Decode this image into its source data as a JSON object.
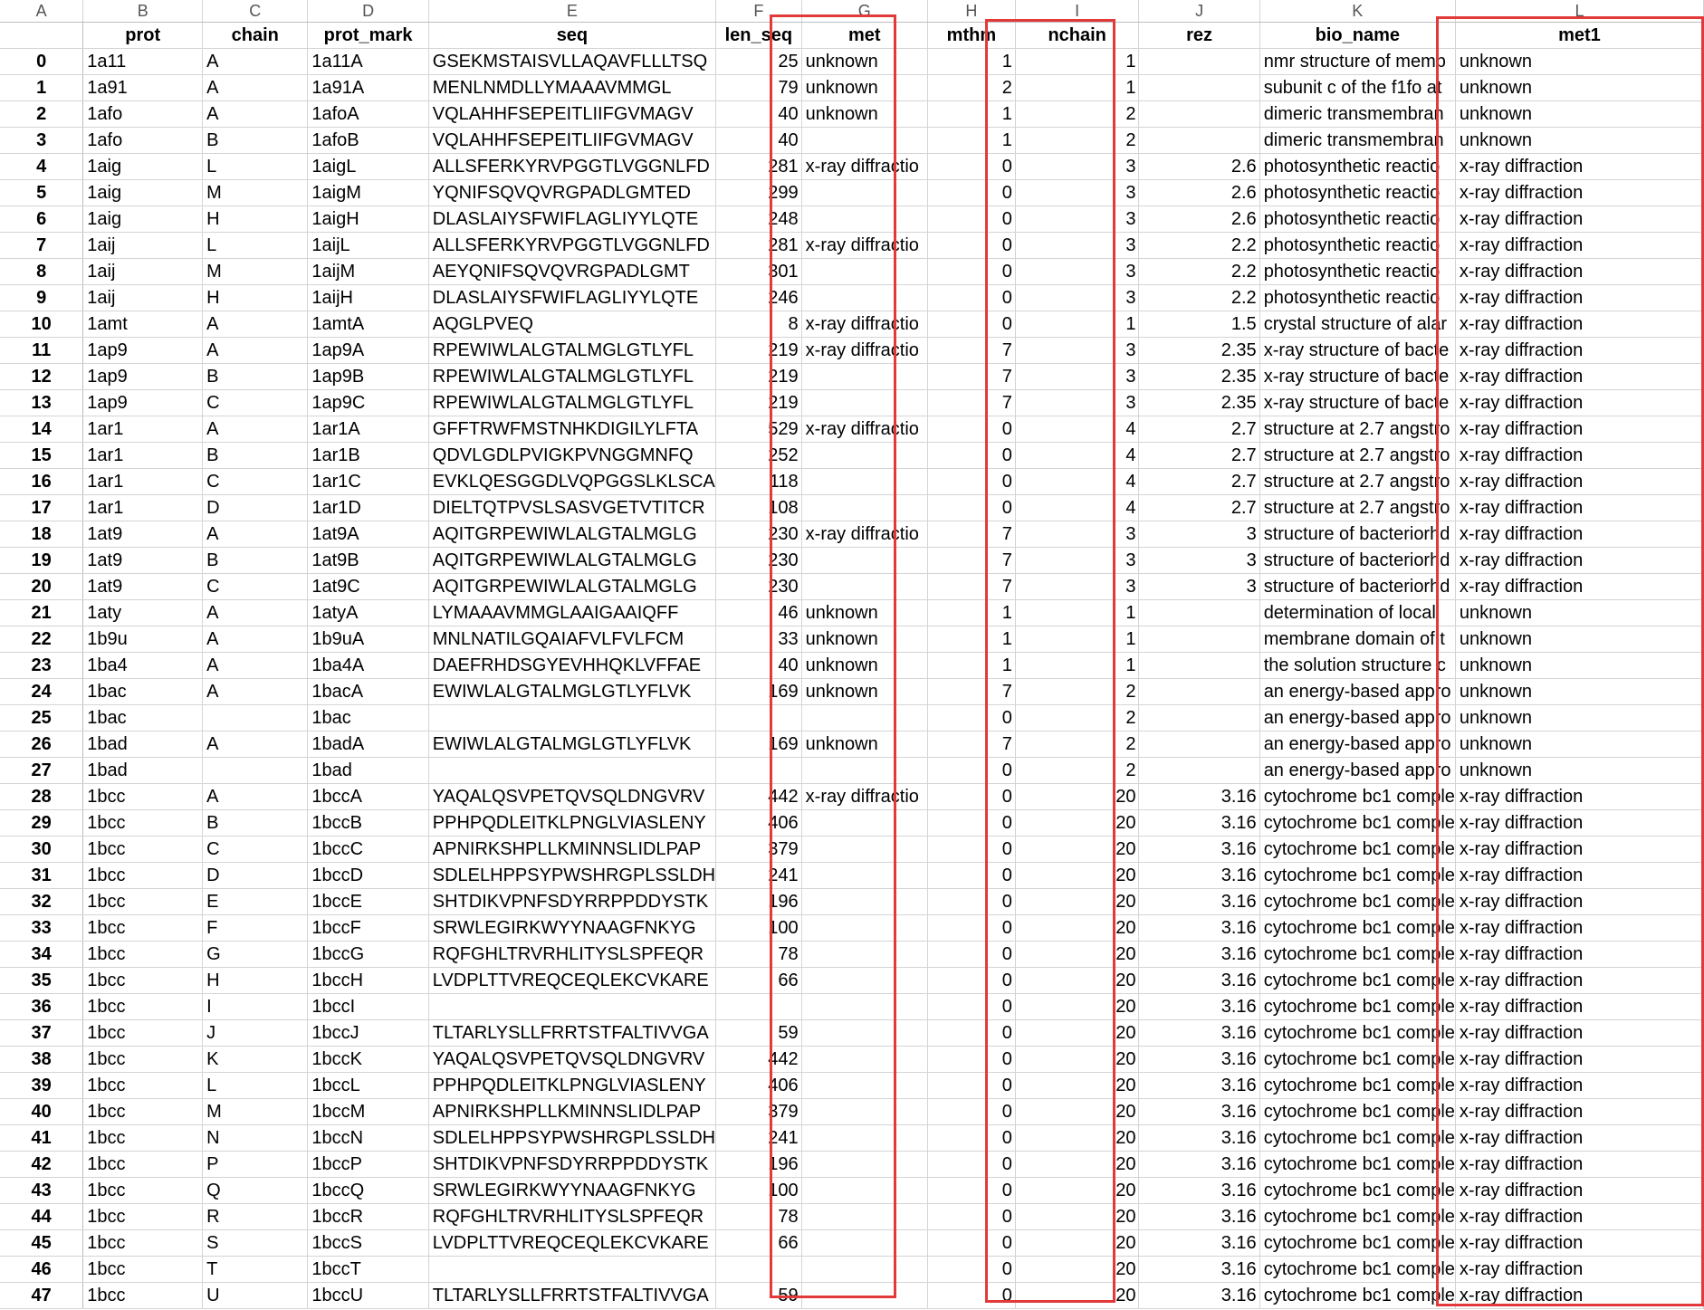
{
  "column_letters": [
    "A",
    "B",
    "C",
    "D",
    "E",
    "F",
    "G",
    "H",
    "I",
    "J",
    "K",
    "L"
  ],
  "headers": [
    "",
    "prot",
    "chain",
    "prot_mark",
    "seq",
    "len_seq",
    "met",
    "mthm",
    "nchain",
    "rez",
    "bio_name",
    "met1"
  ],
  "highlight_color": "#e23a3a",
  "highlighted_columns": [
    "met",
    "nchain",
    "met1"
  ],
  "rows": [
    [
      "0",
      "1a11",
      "A",
      "1a11A",
      "GSEKMSTAISVLLAQAVFLLLTSQ",
      "25",
      "unknown",
      "1",
      "1",
      "",
      "nmr structure of memb",
      "unknown"
    ],
    [
      "1",
      "1a91",
      "A",
      "1a91A",
      "MENLNMDLLYMAAAVMMGL",
      "79",
      "unknown",
      "2",
      "1",
      "",
      "subunit c of the f1fo at",
      "unknown"
    ],
    [
      "2",
      "1afo",
      "A",
      "1afoA",
      "VQLAHHFSEPEITLIIFGVMAGV",
      "40",
      "unknown",
      "1",
      "2",
      "",
      "dimeric transmembran",
      "unknown"
    ],
    [
      "3",
      "1afo",
      "B",
      "1afoB",
      "VQLAHHFSEPEITLIIFGVMAGV",
      "40",
      "",
      "1",
      "2",
      "",
      "dimeric transmembran",
      "unknown"
    ],
    [
      "4",
      "1aig",
      "L",
      "1aigL",
      "ALLSFERKYRVPGGTLVGGNLFD",
      "281",
      "x-ray diffractio",
      "0",
      "3",
      "2.6",
      "photosynthetic reactio",
      "x-ray diffraction"
    ],
    [
      "5",
      "1aig",
      "M",
      "1aigM",
      "YQNIFSQVQVRGPADLGMTED",
      "299",
      "",
      "0",
      "3",
      "2.6",
      "photosynthetic reactio",
      "x-ray diffraction"
    ],
    [
      "6",
      "1aig",
      "H",
      "1aigH",
      "DLASLAIYSFWIFLAGLIYYLQTE",
      "248",
      "",
      "0",
      "3",
      "2.6",
      "photosynthetic reactio",
      "x-ray diffraction"
    ],
    [
      "7",
      "1aij",
      "L",
      "1aijL",
      "ALLSFERKYRVPGGTLVGGNLFD",
      "281",
      "x-ray diffractio",
      "0",
      "3",
      "2.2",
      "photosynthetic reactio",
      "x-ray diffraction"
    ],
    [
      "8",
      "1aij",
      "M",
      "1aijM",
      "AEYQNIFSQVQVRGPADLGMT",
      "301",
      "",
      "0",
      "3",
      "2.2",
      "photosynthetic reactio",
      "x-ray diffraction"
    ],
    [
      "9",
      "1aij",
      "H",
      "1aijH",
      "DLASLAIYSFWIFLAGLIYYLQTE",
      "246",
      "",
      "0",
      "3",
      "2.2",
      "photosynthetic reactio",
      "x-ray diffraction"
    ],
    [
      "10",
      "1amt",
      "A",
      "1amtA",
      "AQGLPVEQ",
      "8",
      "x-ray diffractio",
      "0",
      "1",
      "1.5",
      "crystal structure of alar",
      "x-ray diffraction"
    ],
    [
      "11",
      "1ap9",
      "A",
      "1ap9A",
      "RPEWIWLALGTALMGLGTLYFL",
      "219",
      "x-ray diffractio",
      "7",
      "3",
      "2.35",
      "x-ray structure of bacte",
      "x-ray diffraction"
    ],
    [
      "12",
      "1ap9",
      "B",
      "1ap9B",
      "RPEWIWLALGTALMGLGTLYFL",
      "219",
      "",
      "7",
      "3",
      "2.35",
      "x-ray structure of bacte",
      "x-ray diffraction"
    ],
    [
      "13",
      "1ap9",
      "C",
      "1ap9C",
      "RPEWIWLALGTALMGLGTLYFL",
      "219",
      "",
      "7",
      "3",
      "2.35",
      "x-ray structure of bacte",
      "x-ray diffraction"
    ],
    [
      "14",
      "1ar1",
      "A",
      "1ar1A",
      "GFFTRWFMSTNHKDIGILYLFTA",
      "529",
      "x-ray diffractio",
      "0",
      "4",
      "2.7",
      "structure at 2.7 angstro",
      "x-ray diffraction"
    ],
    [
      "15",
      "1ar1",
      "B",
      "1ar1B",
      "QDVLGDLPVIGKPVNGGMNFQ",
      "252",
      "",
      "0",
      "4",
      "2.7",
      "structure at 2.7 angstro",
      "x-ray diffraction"
    ],
    [
      "16",
      "1ar1",
      "C",
      "1ar1C",
      "EVKLQESGGDLVQPGGSLKLSCA",
      "118",
      "",
      "0",
      "4",
      "2.7",
      "structure at 2.7 angstro",
      "x-ray diffraction"
    ],
    [
      "17",
      "1ar1",
      "D",
      "1ar1D",
      "DIELTQTPVSLSASVGETVTITCR",
      "108",
      "",
      "0",
      "4",
      "2.7",
      "structure at 2.7 angstro",
      "x-ray diffraction"
    ],
    [
      "18",
      "1at9",
      "A",
      "1at9A",
      "AQITGRPEWIWLALGTALMGLG",
      "230",
      "x-ray diffractio",
      "7",
      "3",
      "3",
      "structure of bacteriorhd",
      "x-ray diffraction"
    ],
    [
      "19",
      "1at9",
      "B",
      "1at9B",
      "AQITGRPEWIWLALGTALMGLG",
      "230",
      "",
      "7",
      "3",
      "3",
      "structure of bacteriorhd",
      "x-ray diffraction"
    ],
    [
      "20",
      "1at9",
      "C",
      "1at9C",
      "AQITGRPEWIWLALGTALMGLG",
      "230",
      "",
      "7",
      "3",
      "3",
      "structure of bacteriorhd",
      "x-ray diffraction"
    ],
    [
      "21",
      "1aty",
      "A",
      "1atyA",
      "LYMAAAVMMGLAAIGAAIQFF",
      "46",
      "unknown",
      "1",
      "1",
      "",
      "determination of local",
      "unknown"
    ],
    [
      "22",
      "1b9u",
      "A",
      "1b9uA",
      "MNLNATILGQAIAFVLFVLFCM",
      "33",
      "unknown",
      "1",
      "1",
      "",
      "membrane domain of t",
      "unknown"
    ],
    [
      "23",
      "1ba4",
      "A",
      "1ba4A",
      "DAEFRHDSGYEVHHQKLVFFAE",
      "40",
      "unknown",
      "1",
      "1",
      "",
      "the solution structure c",
      "unknown"
    ],
    [
      "24",
      "1bac",
      "A",
      "1bacA",
      "EWIWLALGTALMGLGTLYFLVK",
      "169",
      "unknown",
      "7",
      "2",
      "",
      "an energy-based appro",
      "unknown"
    ],
    [
      "25",
      "1bac",
      "",
      "1bac",
      "",
      "",
      "",
      "0",
      "2",
      "",
      "an energy-based appro",
      "unknown"
    ],
    [
      "26",
      "1bad",
      "A",
      "1badA",
      "EWIWLALGTALMGLGTLYFLVK",
      "169",
      "unknown",
      "7",
      "2",
      "",
      "an energy-based appro",
      "unknown"
    ],
    [
      "27",
      "1bad",
      "",
      "1bad",
      "",
      "",
      "",
      "0",
      "2",
      "",
      "an energy-based appro",
      "unknown"
    ],
    [
      "28",
      "1bcc",
      "A",
      "1bccA",
      "YAQALQSVPETQVSQLDNGVRV",
      "442",
      "x-ray diffractio",
      "0",
      "20",
      "3.16",
      "cytochrome bc1 comple",
      "x-ray diffraction"
    ],
    [
      "29",
      "1bcc",
      "B",
      "1bccB",
      "PPHPQDLEITKLPNGLVIASLENY",
      "406",
      "",
      "0",
      "20",
      "3.16",
      "cytochrome bc1 comple",
      "x-ray diffraction"
    ],
    [
      "30",
      "1bcc",
      "C",
      "1bccC",
      "APNIRKSHPLLKMINNSLIDLPAP",
      "379",
      "",
      "0",
      "20",
      "3.16",
      "cytochrome bc1 comple",
      "x-ray diffraction"
    ],
    [
      "31",
      "1bcc",
      "D",
      "1bccD",
      "SDLELHPPSYPWSHRGPLSSLDH",
      "241",
      "",
      "0",
      "20",
      "3.16",
      "cytochrome bc1 comple",
      "x-ray diffraction"
    ],
    [
      "32",
      "1bcc",
      "E",
      "1bccE",
      "SHTDIKVPNFSDYRRPPDDYSTK",
      "196",
      "",
      "0",
      "20",
      "3.16",
      "cytochrome bc1 comple",
      "x-ray diffraction"
    ],
    [
      "33",
      "1bcc",
      "F",
      "1bccF",
      "SRWLEGIRKWYYNAAGFNKYG",
      "100",
      "",
      "0",
      "20",
      "3.16",
      "cytochrome bc1 comple",
      "x-ray diffraction"
    ],
    [
      "34",
      "1bcc",
      "G",
      "1bccG",
      "RQFGHLTRVRHLITYSLSPFEQR",
      "78",
      "",
      "0",
      "20",
      "3.16",
      "cytochrome bc1 comple",
      "x-ray diffraction"
    ],
    [
      "35",
      "1bcc",
      "H",
      "1bccH",
      "LVDPLTTVREQCEQLEKCVKARE",
      "66",
      "",
      "0",
      "20",
      "3.16",
      "cytochrome bc1 comple",
      "x-ray diffraction"
    ],
    [
      "36",
      "1bcc",
      "I",
      "1bccI",
      "",
      "",
      "",
      "0",
      "20",
      "3.16",
      "cytochrome bc1 comple",
      "x-ray diffraction"
    ],
    [
      "37",
      "1bcc",
      "J",
      "1bccJ",
      "TLTARLYSLLFRRTSTFALTIVVGA",
      "59",
      "",
      "0",
      "20",
      "3.16",
      "cytochrome bc1 comple",
      "x-ray diffraction"
    ],
    [
      "38",
      "1bcc",
      "K",
      "1bccK",
      "YAQALQSVPETQVSQLDNGVRV",
      "442",
      "",
      "0",
      "20",
      "3.16",
      "cytochrome bc1 comple",
      "x-ray diffraction"
    ],
    [
      "39",
      "1bcc",
      "L",
      "1bccL",
      "PPHPQDLEITKLPNGLVIASLENY",
      "406",
      "",
      "0",
      "20",
      "3.16",
      "cytochrome bc1 comple",
      "x-ray diffraction"
    ],
    [
      "40",
      "1bcc",
      "M",
      "1bccM",
      "APNIRKSHPLLKMINNSLIDLPAP",
      "379",
      "",
      "0",
      "20",
      "3.16",
      "cytochrome bc1 comple",
      "x-ray diffraction"
    ],
    [
      "41",
      "1bcc",
      "N",
      "1bccN",
      "SDLELHPPSYPWSHRGPLSSLDH",
      "241",
      "",
      "0",
      "20",
      "3.16",
      "cytochrome bc1 comple",
      "x-ray diffraction"
    ],
    [
      "42",
      "1bcc",
      "P",
      "1bccP",
      "SHTDIKVPNFSDYRRPPDDYSTK",
      "196",
      "",
      "0",
      "20",
      "3.16",
      "cytochrome bc1 comple",
      "x-ray diffraction"
    ],
    [
      "43",
      "1bcc",
      "Q",
      "1bccQ",
      "SRWLEGIRKWYYNAAGFNKYG",
      "100",
      "",
      "0",
      "20",
      "3.16",
      "cytochrome bc1 comple",
      "x-ray diffraction"
    ],
    [
      "44",
      "1bcc",
      "R",
      "1bccR",
      "RQFGHLTRVRHLITYSLSPFEQR",
      "78",
      "",
      "0",
      "20",
      "3.16",
      "cytochrome bc1 comple",
      "x-ray diffraction"
    ],
    [
      "45",
      "1bcc",
      "S",
      "1bccS",
      "LVDPLTTVREQCEQLEKCVKARE",
      "66",
      "",
      "0",
      "20",
      "3.16",
      "cytochrome bc1 comple",
      "x-ray diffraction"
    ],
    [
      "46",
      "1bcc",
      "T",
      "1bccT",
      "",
      "",
      "",
      "0",
      "20",
      "3.16",
      "cytochrome bc1 comple",
      "x-ray diffraction"
    ],
    [
      "47",
      "1bcc",
      "U",
      "1bccU",
      "TLTARLYSLLFRRTSTFALTIVVGA",
      "59",
      "",
      "0",
      "20",
      "3.16",
      "cytochrome bc1 comple",
      "x-ray diffraction"
    ]
  ]
}
